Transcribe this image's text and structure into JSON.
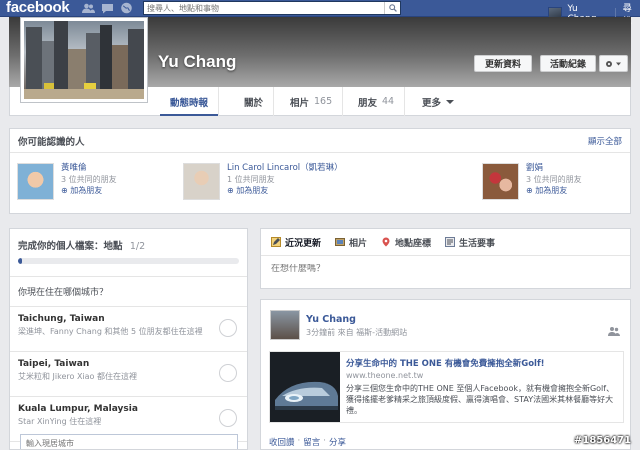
{
  "topbar": {
    "logo": "facebook",
    "search_placeholder": "搜尋人、地點和事物",
    "user_name": "Yu Chang",
    "home_label": "尋找"
  },
  "profile": {
    "name": "Yu Chang",
    "update_info_label": "更新資料",
    "activity_log_label": "活動紀錄",
    "tabs": [
      {
        "label": "動態時報",
        "count": ""
      },
      {
        "label": "關於",
        "count": ""
      },
      {
        "label": "相片",
        "count": "165"
      },
      {
        "label": "朋友",
        "count": "44"
      },
      {
        "label": "更多",
        "count": ""
      }
    ]
  },
  "pymk": {
    "title": "你可能認識的人",
    "see_all": "顯示全部",
    "people": [
      {
        "name": "黃唯倫",
        "mutual": "3 位共同的朋友",
        "add": "加為朋友"
      },
      {
        "name": "Lin Carol Lincarol（凱若琳）",
        "mutual": "1 位共同朋友",
        "add": "加為朋友"
      },
      {
        "name": "劉娟",
        "mutual": "3 位共同的朋友",
        "add": "加為朋友"
      }
    ]
  },
  "profile_completion": {
    "title": "完成你的個人檔案：地點",
    "fraction": "1/2",
    "progress": 0.02,
    "question": "你現在住在哪個城市？",
    "cities": [
      {
        "name": "Taichung, Taiwan",
        "sub": "梁進坤、Fanny Chang 和其他 5 位朋友都住在這裡"
      },
      {
        "name": "Taipei, Taiwan",
        "sub": "艾米粒和 Jikero Xiao 都住在這裡"
      },
      {
        "name": "Kuala Lumpur, Malaysia",
        "sub": "Star XinYing 住在這裡"
      }
    ],
    "input_placeholder": "輸入現居城市"
  },
  "composer": {
    "tabs": [
      "近況更新",
      "相片",
      "地點座標",
      "生活要事"
    ],
    "placeholder": "在想什麼嗎？"
  },
  "story": {
    "author": "Yu Chang",
    "meta_time": "3分鐘前",
    "meta_via": "來自 福斯-活動網站",
    "link_title": "分享生命中的 THE ONE 有機會免費擁抱全新Golf!",
    "link_url": "www.theone.net.tw",
    "link_desc": "分享三個您生命中的THE ONE 至個人Facebook，就有機會擁抱全新Golf、獲得搖擺老爹精采之旅頂級度假、贏得演唱會、STAY法國米其林餐廳等好大禮。",
    "actions": [
      "收回讚",
      "留言",
      "分享"
    ]
  },
  "watermark": "#1856471"
}
